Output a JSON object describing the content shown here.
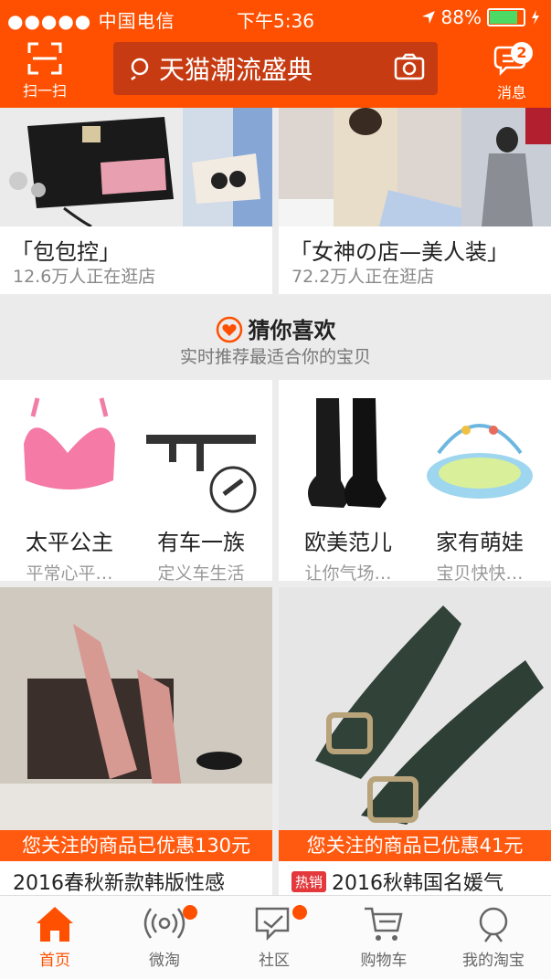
{
  "status": {
    "carrier": "●●●●● 中国电信",
    "time": "下午5:36",
    "battery": "88%"
  },
  "header": {
    "scan_label": "扫一扫",
    "search_text": "天猫潮流盛典",
    "message_label": "消息",
    "message_count": "2"
  },
  "shops": [
    {
      "title": "「包包控」",
      "subtitle": "12.6万人正在逛店"
    },
    {
      "title": "「女神の店—美人装」",
      "subtitle": "72.2万人正在逛店"
    }
  ],
  "guess": {
    "title": "猜你喜欢",
    "subtitle": "实时推荐最适合你的宝贝"
  },
  "categories": [
    {
      "name": "太平公主",
      "desc": "平常心平…"
    },
    {
      "name": "有车一族",
      "desc": "定义车生活"
    },
    {
      "name": "欧美范儿",
      "desc": "让你气场…"
    },
    {
      "name": "家有萌娃",
      "desc": "宝贝快快…"
    }
  ],
  "products": [
    {
      "promo": "您关注的商品已优惠130元",
      "title": "2016春秋新款韩版性感"
    },
    {
      "promo": "您关注的商品已优惠41元",
      "badge": "热销",
      "title": "2016秋韩国名媛气"
    }
  ],
  "tabs": [
    {
      "label": "首页",
      "icon": "home-icon"
    },
    {
      "label": "微淘",
      "icon": "broadcast-icon"
    },
    {
      "label": "社区",
      "icon": "chat-icon"
    },
    {
      "label": "购物车",
      "icon": "cart-icon"
    },
    {
      "label": "我的淘宝",
      "icon": "user-icon"
    }
  ],
  "colors": {
    "brand": "#fe5000",
    "promo": "#ff5a0f",
    "hot": "#e4393c"
  }
}
